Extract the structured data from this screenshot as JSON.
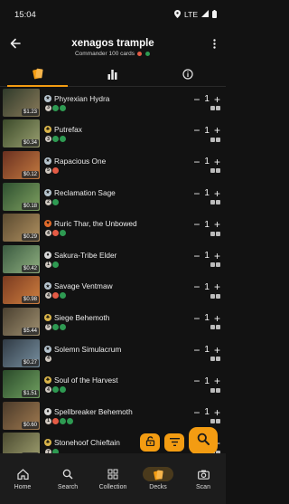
{
  "status": {
    "time": "15:04",
    "network": "LTE"
  },
  "header": {
    "title": "xenagos trample",
    "subtitle": "Commander 100 cards",
    "colors": [
      "#e45b45",
      "#2e9a52"
    ]
  },
  "tabs": [
    {
      "icon": "cards-icon",
      "active": true
    },
    {
      "icon": "bar-chart-icon",
      "active": false
    },
    {
      "icon": "info-icon",
      "active": false
    }
  ],
  "cards": [
    {
      "name": "Phyrexian Hydra",
      "price": "$1.23",
      "quantity": "1",
      "rarity": "uncommon",
      "cost": [
        {
          "t": "generic",
          "v": "3"
        },
        {
          "t": "g",
          "v": ""
        },
        {
          "t": "g",
          "v": ""
        }
      ],
      "art": [
        "#2f3a2a",
        "#8a7b5a"
      ]
    },
    {
      "name": "Putrefax",
      "price": "$0.34",
      "quantity": "1",
      "rarity": "rare",
      "cost": [
        {
          "t": "generic",
          "v": "3"
        },
        {
          "t": "g",
          "v": ""
        },
        {
          "t": "g",
          "v": ""
        }
      ],
      "art": [
        "#3b4a2a",
        "#9aa070"
      ]
    },
    {
      "name": "Rapacious One",
      "price": "$0.12",
      "quantity": "1",
      "rarity": "uncommon",
      "cost": [
        {
          "t": "generic",
          "v": "5"
        },
        {
          "t": "r",
          "v": ""
        }
      ],
      "art": [
        "#6a3020",
        "#c47a40"
      ]
    },
    {
      "name": "Reclamation Sage",
      "price": "$0.18",
      "quantity": "1",
      "rarity": "uncommon",
      "cost": [
        {
          "t": "generic",
          "v": "2"
        },
        {
          "t": "g",
          "v": ""
        }
      ],
      "art": [
        "#2e5030",
        "#7fa060"
      ]
    },
    {
      "name": "Ruric Thar, the Unbowed",
      "price": "$0.29",
      "quantity": "1",
      "rarity": "mythic",
      "cost": [
        {
          "t": "generic",
          "v": "4"
        },
        {
          "t": "r",
          "v": ""
        },
        {
          "t": "g",
          "v": ""
        }
      ],
      "art": [
        "#5a4a30",
        "#b09060"
      ]
    },
    {
      "name": "Sakura-Tribe Elder",
      "price": "$0.42",
      "quantity": "1",
      "rarity": "common",
      "cost": [
        {
          "t": "generic",
          "v": "1"
        },
        {
          "t": "g",
          "v": ""
        }
      ],
      "art": [
        "#3a5a40",
        "#90b080"
      ]
    },
    {
      "name": "Savage Ventmaw",
      "price": "$0.98",
      "quantity": "1",
      "rarity": "uncommon",
      "cost": [
        {
          "t": "generic",
          "v": "4"
        },
        {
          "t": "r",
          "v": ""
        },
        {
          "t": "g",
          "v": ""
        }
      ],
      "art": [
        "#7a3a20",
        "#d08040"
      ]
    },
    {
      "name": "Siege Behemoth",
      "price": "$5.44",
      "quantity": "1",
      "rarity": "rare",
      "cost": [
        {
          "t": "generic",
          "v": "5"
        },
        {
          "t": "g",
          "v": ""
        },
        {
          "t": "g",
          "v": ""
        }
      ],
      "art": [
        "#4a4030",
        "#a09070"
      ]
    },
    {
      "name": "Solemn Simulacrum",
      "price": "$0.27",
      "quantity": "1",
      "rarity": "uncommon",
      "cost": [
        {
          "t": "generic",
          "v": "4"
        }
      ],
      "art": [
        "#303a44",
        "#7890a0"
      ]
    },
    {
      "name": "Soul of the Harvest",
      "price": "$1.51",
      "quantity": "1",
      "rarity": "rare",
      "cost": [
        {
          "t": "generic",
          "v": "4"
        },
        {
          "t": "g",
          "v": ""
        },
        {
          "t": "g",
          "v": ""
        }
      ],
      "art": [
        "#2a4a2a",
        "#70a060"
      ]
    },
    {
      "name": "Spellbreaker Behemoth",
      "price": "$0.60",
      "quantity": "1",
      "rarity": "common",
      "cost": [
        {
          "t": "generic",
          "v": "1"
        },
        {
          "t": "r",
          "v": ""
        },
        {
          "t": "g",
          "v": ""
        },
        {
          "t": "g",
          "v": ""
        }
      ],
      "art": [
        "#4a3a2a",
        "#a07a50"
      ]
    },
    {
      "name": "Stonehoof Chieftain",
      "price": "$1.45",
      "quantity": "1",
      "rarity": "rare",
      "cost": [
        {
          "t": "generic",
          "v": "7"
        },
        {
          "t": "g",
          "v": ""
        }
      ],
      "art": [
        "#4a4a30",
        "#a0a070"
      ]
    }
  ],
  "fabs": {
    "lock": "lock-open-icon",
    "filter": "filter-icon",
    "search": "search-icon"
  },
  "nav": [
    {
      "label": "Home",
      "icon": "home-icon",
      "active": false
    },
    {
      "label": "Search",
      "icon": "search-icon",
      "active": false
    },
    {
      "label": "Collection",
      "icon": "collection-icon",
      "active": false
    },
    {
      "label": "Decks",
      "icon": "decks-icon",
      "active": true
    },
    {
      "label": "Scan",
      "icon": "camera-icon",
      "active": false
    }
  ],
  "accent": "#f39c12"
}
